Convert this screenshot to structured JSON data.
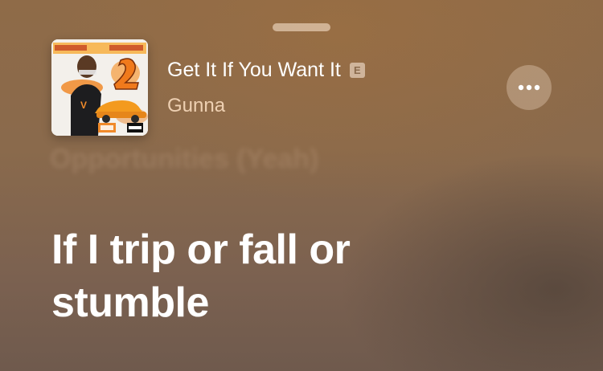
{
  "now_playing": {
    "title": "Get It If You Want It",
    "explicit_badge": "E",
    "artist": "Gunna",
    "artwork_icon": "album-artwork",
    "more_icon": "ellipsis-icon"
  },
  "lyrics": {
    "previous_line": "Opportunities (Yeah)",
    "current_line": "If I trip or fall or stumble"
  },
  "colors": {
    "accent_text": "#ffe2c4",
    "background": "#8a6a4c"
  }
}
